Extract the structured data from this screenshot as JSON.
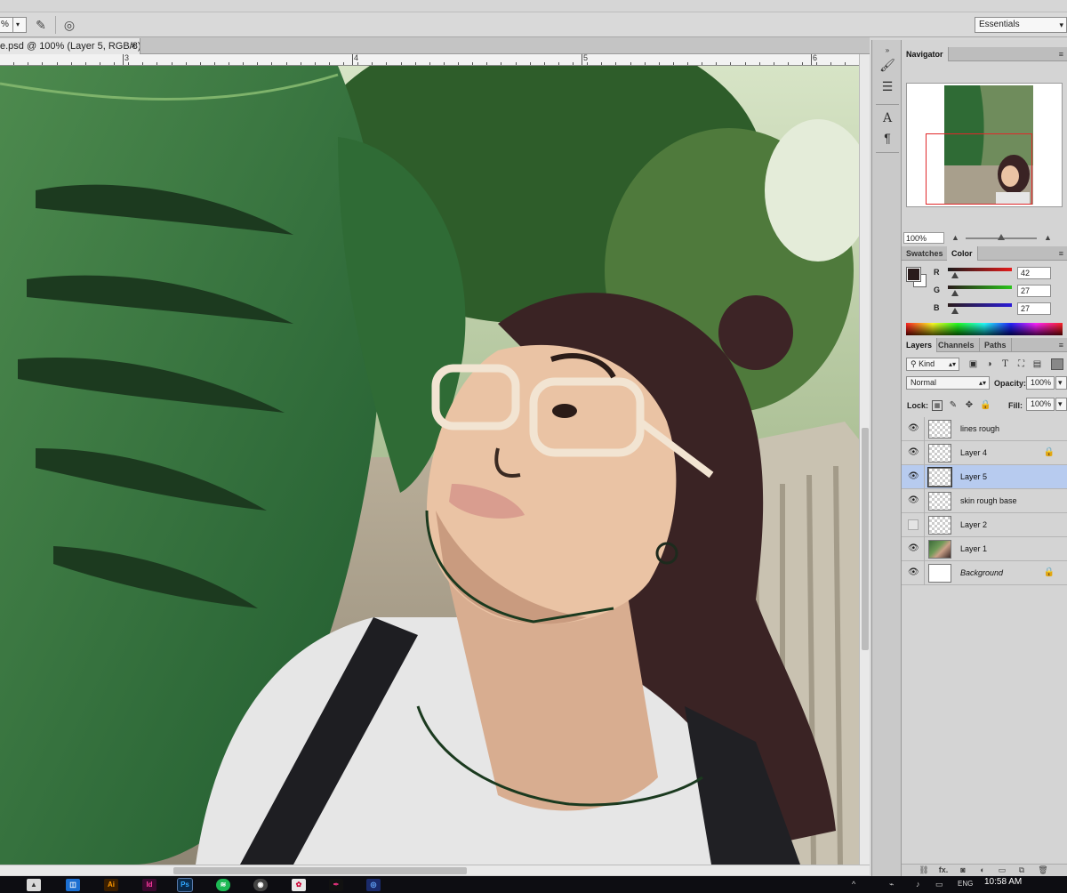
{
  "options_bar": {
    "zoom_value": "%",
    "workspace": "Essentials"
  },
  "document": {
    "tab_title": "e.psd @ 100% (Layer 5, RGB/8)",
    "close_glyph": "×"
  },
  "ruler": {
    "labels": [
      "3",
      "4",
      "5",
      "6"
    ]
  },
  "navigator": {
    "tab": "Navigator",
    "zoom": "100%"
  },
  "color_panel": {
    "tabs": [
      "Swatches",
      "Color"
    ],
    "active_tab": "Color",
    "foreground_color": "#2a1b1b",
    "r_label": "R",
    "g_label": "G",
    "b_label": "B",
    "r": "42",
    "g": "27",
    "b": "27"
  },
  "layers_panel": {
    "tabs": [
      "Layers",
      "Channels",
      "Paths"
    ],
    "filter_kind": "Kind",
    "blend_mode": "Normal",
    "opacity_label": "Opacity:",
    "opacity": "100%",
    "lock_label": "Lock:",
    "fill_label": "Fill:",
    "fill": "100%",
    "layers": [
      {
        "name": "lines rough",
        "visible": true,
        "locked": false,
        "selected": false
      },
      {
        "name": "Layer 4",
        "visible": true,
        "locked": true,
        "selected": false
      },
      {
        "name": "Layer 5",
        "visible": true,
        "locked": false,
        "selected": true
      },
      {
        "name": "skin rough base",
        "visible": true,
        "locked": false,
        "selected": false
      },
      {
        "name": "Layer 2",
        "visible": false,
        "locked": false,
        "selected": false
      },
      {
        "name": "Layer 1",
        "visible": true,
        "locked": false,
        "selected": false
      },
      {
        "name": "Background",
        "visible": true,
        "locked": true,
        "selected": false
      }
    ],
    "footer_fx": "fx."
  },
  "taskbar": {
    "language": "ENG",
    "time": "10:58 AM"
  },
  "colors": {
    "selected_layer": "#b7cbef",
    "navigator_view_box": "#e0282a"
  }
}
